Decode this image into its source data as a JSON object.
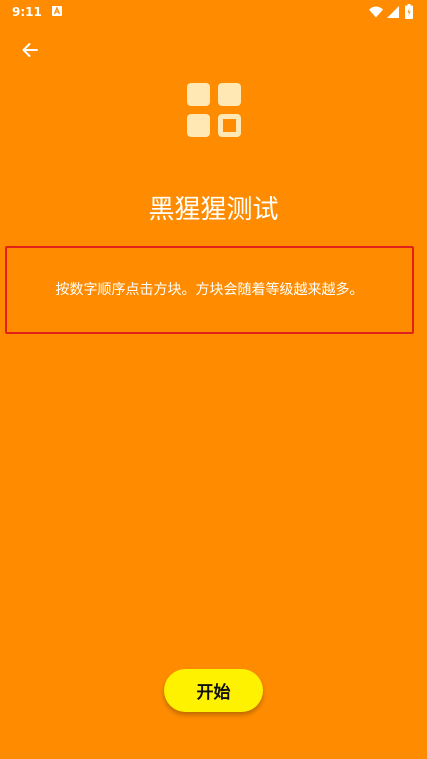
{
  "status_bar": {
    "time": "9:11",
    "icons": [
      "notification-a-icon",
      "wifi-icon",
      "signal-icon",
      "battery-icon"
    ]
  },
  "header": {
    "back_icon": "arrow-back-icon"
  },
  "main": {
    "app_icon": "grid-squares-icon",
    "title": "黑猩猩测试",
    "instruction": "按数字顺序点击方块。方块会随着等级越来越多。",
    "start_label": "开始"
  },
  "colors": {
    "background": "#FF8C00",
    "accent_button": "#FFF200",
    "highlight_border": "#E0221A",
    "icon_tile": "#FFE8B3",
    "text": "#FFFFFF"
  }
}
